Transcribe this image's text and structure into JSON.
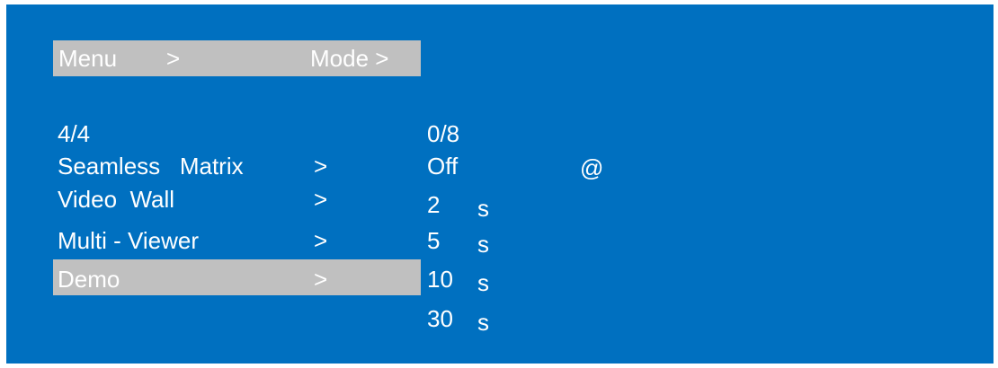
{
  "header": {
    "menu_label": "Menu",
    "menu_arrow": ">",
    "mode_label": "Mode >"
  },
  "left_menu": {
    "counter": "4/4",
    "items": [
      {
        "label": "Seamless   Matrix",
        "arrow": ">"
      },
      {
        "label": "Video  Wall",
        "arrow": ">"
      },
      {
        "label": "Multi - Viewer",
        "arrow": ">"
      },
      {
        "label": "Demo",
        "arrow": ">",
        "selected": true
      }
    ]
  },
  "right_menu": {
    "counter": "0/8",
    "options": [
      {
        "value": "Off",
        "unit": "",
        "marker": "@"
      },
      {
        "value": "2",
        "unit": "s"
      },
      {
        "value": "5",
        "unit": "s"
      },
      {
        "value": "10",
        "unit": "s",
        "selected": true
      },
      {
        "value": "30",
        "unit": "s"
      }
    ]
  },
  "colors": {
    "background": "#0070c0",
    "highlight": "#c0c0c0",
    "text": "#ffffff"
  }
}
